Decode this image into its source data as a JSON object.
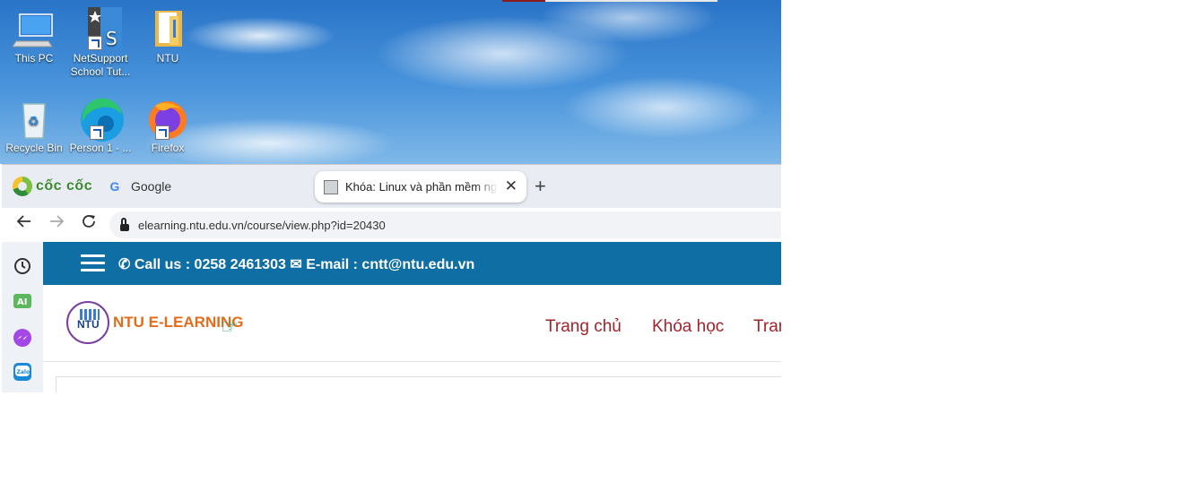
{
  "desktop": {
    "icons": [
      {
        "label": "This PC",
        "icon": "computer-icon"
      },
      {
        "label": "NetSupport School Tut...",
        "icon": "netsupport-icon"
      },
      {
        "label": "NTU",
        "icon": "folder-icon"
      },
      {
        "label": "Recycle Bin",
        "icon": "recycle-bin-icon"
      },
      {
        "label": "Person 1 - ...",
        "icon": "edge-icon"
      },
      {
        "label": "Firefox",
        "icon": "firefox-icon"
      }
    ]
  },
  "browser": {
    "brand": "cốc cốc",
    "tabs": [
      {
        "label": "Google"
      },
      {
        "label": "Khóa: Linux và phần mềm ngu"
      }
    ],
    "active_tab_index": 1,
    "close_glyph": "✕",
    "new_tab_glyph": "+",
    "address": "elearning.ntu.edu.vn/course/view.php?id=20430",
    "sidebar": [
      {
        "icon": "history-icon"
      },
      {
        "icon": "ai-icon",
        "label": "AI"
      },
      {
        "icon": "messenger-icon"
      },
      {
        "icon": "zalo-icon",
        "label": "Zalo"
      }
    ]
  },
  "site": {
    "call_us": "Call us : 0258 2461303",
    "email": "E-mail : cntt@ntu.edu.vn",
    "logo_text": "NTU",
    "brand_name": "NTU E-LEARNING",
    "menu": [
      "Trang chủ",
      "Khóa học",
      "Tran"
    ]
  },
  "colors": {
    "infobar": "#0f6ea4",
    "menu_text": "#a3232b",
    "brand_orange": "#e36c1b"
  }
}
